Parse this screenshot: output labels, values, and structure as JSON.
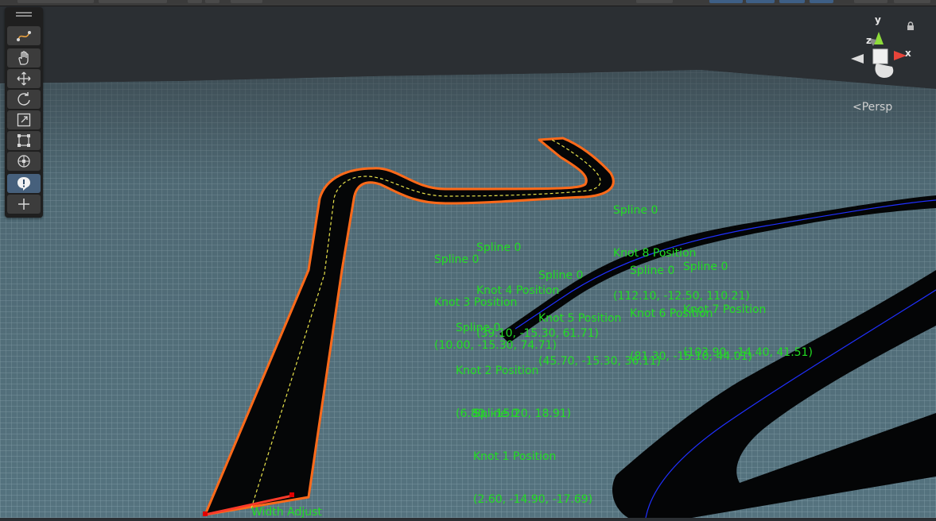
{
  "toolbar": {
    "tools": [
      {
        "name": "spline-tool-icon",
        "active": false
      },
      {
        "name": "hand-tool-icon",
        "active": false
      },
      {
        "name": "move-tool-icon",
        "active": false
      },
      {
        "name": "rotate-tool-icon",
        "active": false
      },
      {
        "name": "scale-tool-icon",
        "active": false
      },
      {
        "name": "rect-tool-icon",
        "active": false
      },
      {
        "name": "transform-tool-icon",
        "active": false
      },
      {
        "name": "custom-tool-icon",
        "active": true
      },
      {
        "name": "add-tool-icon",
        "active": false
      }
    ]
  },
  "gizmo": {
    "x_label": "x",
    "y_label": "y",
    "z_label": "z",
    "projection_label": "Persp"
  },
  "knots": [
    {
      "spline": "Spline 0",
      "knot": "Knot 1 Position",
      "pos": "(2.60, -14.90, -17.69)"
    },
    {
      "spline": "Spline 0",
      "knot": "Knot 2 Position",
      "pos": "(6.80, -15.20, 18.91)"
    },
    {
      "spline": "Spline 0",
      "knot": "Knot 3 Position",
      "pos": "(10.00, -15.30, 74.71)"
    },
    {
      "spline": "Spline 0",
      "knot": "Knot 4 Position",
      "pos": "(39.10, -15.30, 61.71)"
    },
    {
      "spline": "Spline 0",
      "knot": "Knot 5 Position",
      "pos": "(45.70, -15.30, 36.11)"
    },
    {
      "spline": "Spline 0",
      "knot": "Knot 6 Position",
      "pos": "(81.30, -15.10, 44.01)"
    },
    {
      "spline": "Spline 0",
      "knot": "Knot 7 Position",
      "pos": "(103.90, -14.40, 41.51)"
    },
    {
      "spline": "Spline 0",
      "knot": "Knot 8 Position",
      "pos": "(112.10, -12.50, 110.21)"
    }
  ],
  "handle_label": "Width Adjust",
  "colors": {
    "label": "#22dd22",
    "road": "#050607",
    "selection_outline": "#ff6a1a",
    "center_line": "#e8e24a",
    "spline_line": "#2030ff",
    "ground": "#4d6b78",
    "sky": "#2b2f33"
  }
}
